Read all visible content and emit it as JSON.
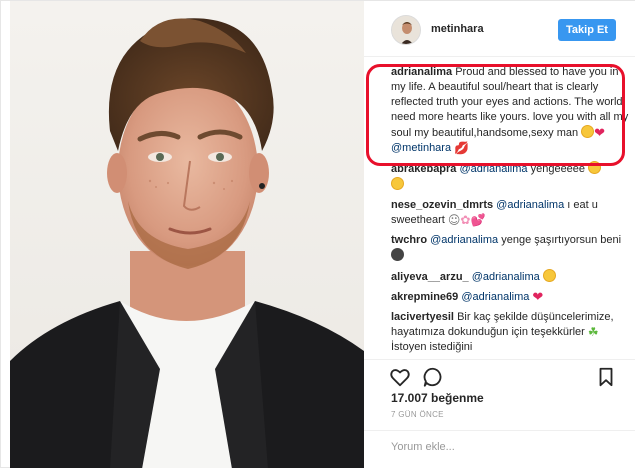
{
  "post": {
    "username": "metinhara",
    "follow_label": "Takip Et"
  },
  "comments": [
    {
      "user": "adrianalima",
      "text": "Proud and blessed to have you in my life. A beautiful soul/heart that is clearly reflected truth your eyes and actions. The world need more hearts like yours. love you with all my soul my beautiful,handsome,sexy man",
      "mention": "@metinhara"
    },
    {
      "user": "abrakebapra",
      "mention": "@adrianalima",
      "text": "yengeeeee"
    },
    {
      "user": "nese_ozevin_dmrts",
      "mention": "@adrianalima",
      "text": "ı eat u sweetheart"
    },
    {
      "user": "twchro",
      "mention": "@adrianalima",
      "text": "yenge şaşırtıyorsun beni"
    },
    {
      "user": "aliyeva__arzu_",
      "mention": "@adrianalima"
    },
    {
      "user": "akrepmine69",
      "mention": "@adrianalima"
    },
    {
      "user": "lacivertyesil",
      "text": "Bir kaç şekilde düşüncelerimize, hayatımıza dokunduğun için teşekkürler",
      "text_tail": "İstoyen istediğini"
    }
  ],
  "footer": {
    "likes": "17.007 beğenme",
    "time_ago": "7 GÜN ÖNCE",
    "comment_placeholder": "Yorum ekle..."
  },
  "icons": {
    "like": "heart-outline-icon",
    "comment": "speech-bubble-icon",
    "save": "bookmark-icon"
  },
  "colors": {
    "follow_button": "#3897f0",
    "highlight": "#e8102b",
    "heart": "#e0245e"
  }
}
